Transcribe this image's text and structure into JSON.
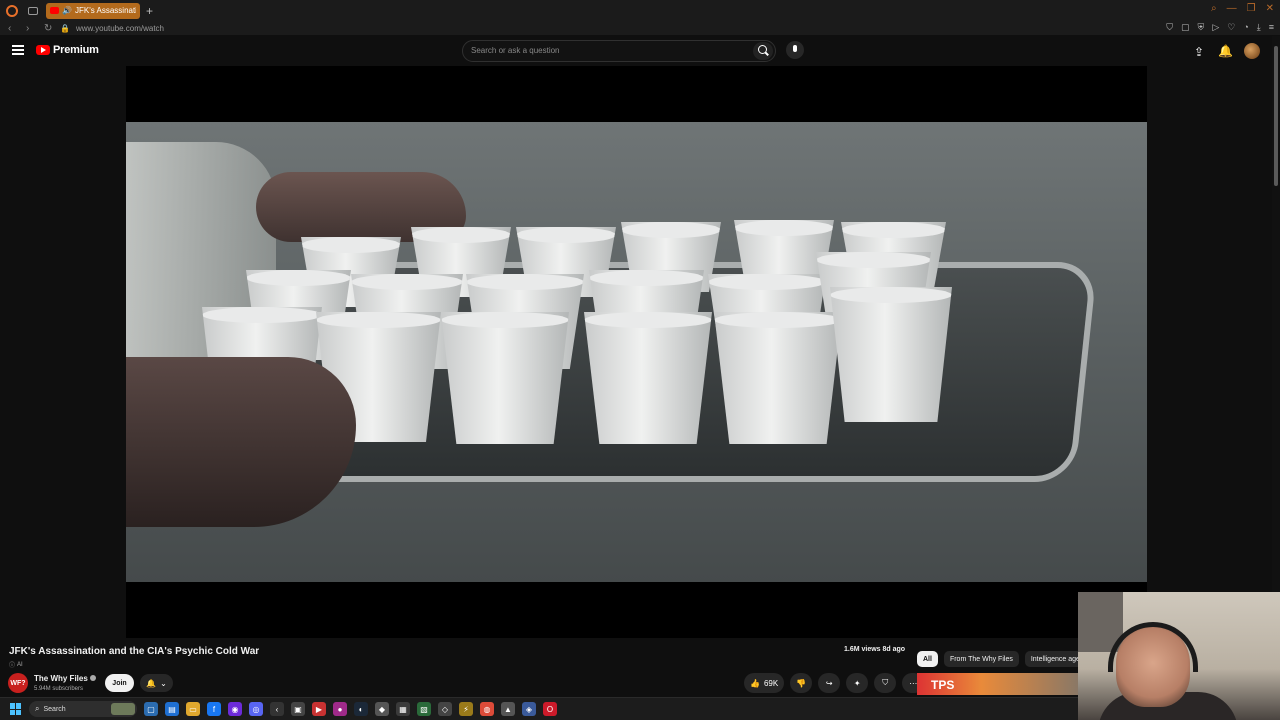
{
  "browser": {
    "tab_title": "JFK's Assassination an",
    "url": "www.youtube.com/watch",
    "new_tab_symbol": "+"
  },
  "youtube": {
    "logo_text": "Premium",
    "search_placeholder": "Search or ask a question"
  },
  "video": {
    "title": "JFK's Assassination and the CIA's Psychic Cold War",
    "ai_label": "AI",
    "views": "1.6M views  8d ago",
    "channel": {
      "avatar_text": "WF?",
      "name": "The Why Files",
      "subscribers": "5.94M subscribers",
      "join_label": "Join"
    },
    "likes": "69K"
  },
  "chips": [
    "All",
    "From The Why Files",
    "Intelligence agen"
  ],
  "recommendation_thumb_text": "TPS",
  "taskbar": {
    "search_label": "Search",
    "icons": [
      {
        "name": "task-view-icon",
        "color": "#2b6cb0",
        "glyph": "▢"
      },
      {
        "name": "store-icon",
        "color": "#1f6fd1",
        "glyph": "▤"
      },
      {
        "name": "file-explorer-icon",
        "color": "#e0a82e",
        "glyph": "▭"
      },
      {
        "name": "facebook-icon",
        "color": "#1877f2",
        "glyph": "f"
      },
      {
        "name": "obs-icon",
        "color": "#6c2bd9",
        "glyph": "◉"
      },
      {
        "name": "discord-icon",
        "color": "#5865f2",
        "glyph": "◎"
      },
      {
        "name": "back-app-icon",
        "color": "#333333",
        "glyph": "‹"
      },
      {
        "name": "app-icon-1",
        "color": "#444444",
        "glyph": "▣"
      },
      {
        "name": "app-icon-2",
        "color": "#c83232",
        "glyph": "▶"
      },
      {
        "name": "app-icon-3",
        "color": "#a02a8a",
        "glyph": "●"
      },
      {
        "name": "steam-icon",
        "color": "#1b2838",
        "glyph": "◐"
      },
      {
        "name": "app-icon-4",
        "color": "#555555",
        "glyph": "◆"
      },
      {
        "name": "app-icon-5",
        "color": "#3a3a3a",
        "glyph": "▦"
      },
      {
        "name": "app-icon-6",
        "color": "#2a6a3a",
        "glyph": "▧"
      },
      {
        "name": "app-icon-7",
        "color": "#444444",
        "glyph": "◇"
      },
      {
        "name": "app-icon-8",
        "color": "#9a7a1a",
        "glyph": "⚡"
      },
      {
        "name": "chrome-icon",
        "color": "#dd4b39",
        "glyph": "◍"
      },
      {
        "name": "app-icon-9",
        "color": "#555555",
        "glyph": "▲"
      },
      {
        "name": "app-icon-10",
        "color": "#3a5a9a",
        "glyph": "◈"
      },
      {
        "name": "opera-icon",
        "color": "#cc1a2a",
        "glyph": "O"
      }
    ]
  },
  "colors": {
    "accent_tab": "#b36a1c",
    "youtube_red": "#ff0000",
    "background": "#0f0f0f"
  }
}
